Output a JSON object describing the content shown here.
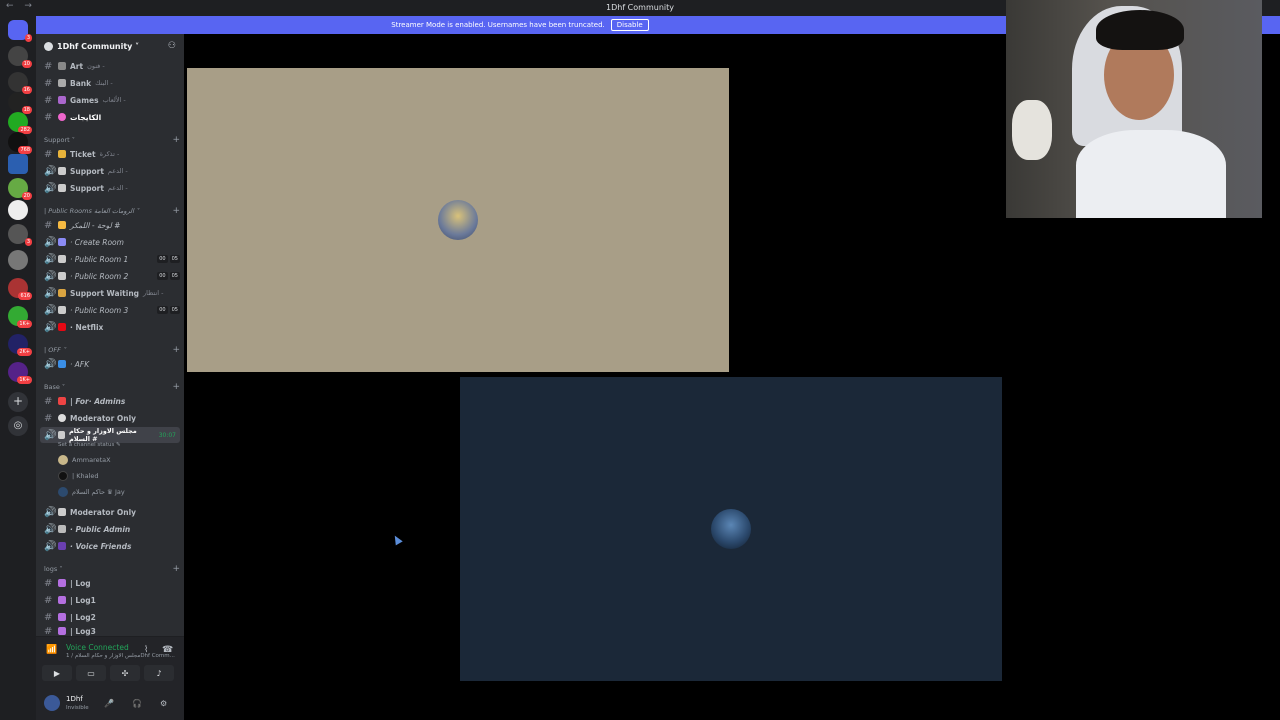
{
  "window": {
    "title": "1Dhf Community",
    "nav": "← →"
  },
  "banner": {
    "text": "Streamer Mode is enabled. Usernames have been truncated.",
    "disable_label": "Disable"
  },
  "server_badges": [
    "3",
    "10",
    "16",
    "18",
    "282",
    "768",
    "20",
    "3",
    "616",
    "1K+",
    "2K+",
    "1K+"
  ],
  "guild": {
    "name": "1Dhf Community ˅",
    "invite_icon": "add-member-icon"
  },
  "channels_top": [
    {
      "name": "Art",
      "ar": "فنون -",
      "type": "text",
      "prefix": "# "
    },
    {
      "name": "Bank",
      "ar": "البنك -",
      "type": "text",
      "prefix": "# "
    },
    {
      "name": "Games",
      "ar": "الألعاب -",
      "type": "text",
      "prefix": "# "
    },
    {
      "name": "الكايجات",
      "ar": "",
      "type": "text",
      "prefix": "# "
    }
  ],
  "categories": {
    "support": "Support ˅",
    "public_rooms": "| Public Rooms  الرومات العامة ˅",
    "off": "| OFF ˅",
    "base": "Base ˅",
    "logs": "logs ˅"
  },
  "support_channels": [
    {
      "name": "Ticket",
      "ar": "تذكرة -",
      "type": "text"
    },
    {
      "name": "Support",
      "ar": "الدعم -",
      "type": "voice"
    },
    {
      "name": "Support",
      "ar": "الدعم -",
      "type": "voice"
    }
  ],
  "public_channels": [
    {
      "name": "لوحة - اللمكر #",
      "type": "text",
      "italic": true
    },
    {
      "name": "· Create Room",
      "type": "voice",
      "italic": true
    },
    {
      "name": "· Public Room 1",
      "type": "voice",
      "italic": true,
      "counts": [
        "00",
        "05"
      ]
    },
    {
      "name": "· Public Room 2",
      "type": "voice",
      "italic": true,
      "counts": [
        "00",
        "05"
      ]
    },
    {
      "name": "Support Waiting",
      "ar": "انتظار -",
      "type": "voice",
      "italic": false
    },
    {
      "name": "· Public Room 3",
      "type": "voice",
      "italic": true,
      "counts": [
        "00",
        "05"
      ]
    },
    {
      "name": "· Netflix",
      "type": "voice",
      "italic": false
    }
  ],
  "off_channels": [
    {
      "name": "· AFK",
      "type": "voice",
      "italic": true
    }
  ],
  "base_channels": [
    {
      "name": "| For· Admins",
      "type": "text",
      "italic": true
    },
    {
      "name": "Moderator Only",
      "type": "text",
      "italic": false
    },
    {
      "name": "مجلس الاوزار و حكام السلام #",
      "type": "voice",
      "active": true,
      "timer": "30:07"
    }
  ],
  "active_status_note": "Set a channel status ✎",
  "voice_users": [
    {
      "name": "AmmaretaX"
    },
    {
      "name": "| Khaled"
    },
    {
      "name": "حاكم السلام ♛ Jay"
    }
  ],
  "base_channels_2": [
    {
      "name": "Moderator Only",
      "type": "voice",
      "italic": false
    },
    {
      "name": "· Public Admin",
      "type": "voice",
      "italic": true
    },
    {
      "name": "· Voice Friends",
      "type": "voice",
      "italic": true
    }
  ],
  "logs_channels": [
    {
      "name": "| Log"
    },
    {
      "name": "| Log1"
    },
    {
      "name": "| Log2"
    },
    {
      "name": "| Log3"
    }
  ],
  "voice_panel": {
    "title": "Voice Connected",
    "subtitle": "مجلس الاوزار و حكام السلام / 1Dhf Comm...",
    "buttons": [
      "camera-icon",
      "screen-share-icon",
      "activities-icon",
      "soundboard-icon"
    ]
  },
  "me": {
    "name": "1Dhf",
    "status": "Invisible"
  },
  "tiles": [
    {
      "color": "#a89e87",
      "avatar_color": "#5a6a8a"
    },
    {
      "color": "#1b2838",
      "avatar_color": "#2c4a6e"
    }
  ],
  "colors": {
    "accent": "#5865f2",
    "online": "#23a55a",
    "badge": "#f23f43"
  }
}
